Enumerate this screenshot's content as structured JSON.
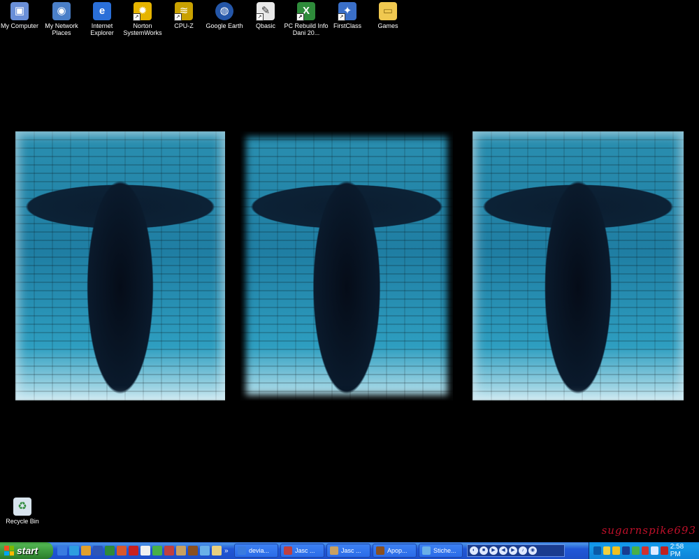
{
  "desktop": {
    "icons": [
      {
        "label": "My Computer",
        "icon": "computer-icon",
        "color": "#6a8fd8",
        "glyph": "▣"
      },
      {
        "label": "My Network Places",
        "icon": "network-icon",
        "color": "#4a7fc8",
        "glyph": "◉"
      },
      {
        "label": "Internet Explorer",
        "icon": "ie-icon",
        "color": "#2a6fd8",
        "glyph": "e"
      },
      {
        "label": "Norton SystemWorks",
        "icon": "norton-icon",
        "color": "#e6b400",
        "glyph": "✹"
      },
      {
        "label": "CPU-Z",
        "icon": "cpuz-icon",
        "color": "#c9a100",
        "glyph": "≋"
      },
      {
        "label": "Google Earth",
        "icon": "google-earth-icon",
        "color": "#2456a8",
        "glyph": "◍"
      },
      {
        "label": "Qbasic",
        "icon": "qbasic-icon",
        "color": "#e8e8e8",
        "glyph": "✎"
      },
      {
        "label": "PC Rebuild Info Dani 20...",
        "icon": "excel-icon",
        "color": "#2e8b3a",
        "glyph": "X"
      },
      {
        "label": "FirstClass",
        "icon": "firstclass-icon",
        "color": "#3a6fc8",
        "glyph": "✦"
      },
      {
        "label": "Games",
        "icon": "folder-icon",
        "color": "#f0c850",
        "glyph": "▭"
      }
    ],
    "recycle_bin": {
      "label": "Recycle Bin",
      "icon": "recycle-bin-icon"
    },
    "watermark": "sugarnspike693"
  },
  "taskbar": {
    "start_label": "start",
    "quick_launch": [
      {
        "icon": "ie-quicklaunch-icon",
        "color": "#3a7be0"
      },
      {
        "icon": "ie-quicklaunch-icon-2",
        "color": "#2d9de0"
      },
      {
        "icon": "media-quicklaunch-icon",
        "color": "#e0a02d"
      },
      {
        "icon": "word-quicklaunch-icon",
        "color": "#2d56b8"
      },
      {
        "icon": "excel-quicklaunch-icon",
        "color": "#2e8b3a"
      },
      {
        "icon": "powerpoint-quicklaunch-icon",
        "color": "#d8582d"
      },
      {
        "icon": "acrobat-quicklaunch-icon",
        "color": "#c82020"
      },
      {
        "icon": "player-quicklaunch-icon",
        "color": "#f0f0f0"
      },
      {
        "icon": "messenger-quicklaunch-icon",
        "color": "#48b048"
      },
      {
        "icon": "jasc-quicklaunch-icon",
        "color": "#c04040"
      },
      {
        "icon": "paint-quicklaunch-icon",
        "color": "#c8a060"
      },
      {
        "icon": "apophysis-quicklaunch-icon",
        "color": "#8a5020"
      },
      {
        "icon": "photo-quicklaunch-icon",
        "color": "#6ab0e8"
      },
      {
        "icon": "explorer-quicklaunch-icon",
        "color": "#e8d080"
      }
    ],
    "more_label": "»",
    "tasks": [
      {
        "label": "devia...",
        "icon": "ie-task-icon",
        "color": "#3a7be0"
      },
      {
        "label": "Jasc ...",
        "icon": "jasc-task-icon",
        "color": "#c04040"
      },
      {
        "label": "Jasc ...",
        "icon": "jasc-task-icon",
        "color": "#c8a060"
      },
      {
        "label": "Apop...",
        "icon": "apophysis-task-icon",
        "color": "#8a5020"
      },
      {
        "label": "Stiche...",
        "icon": "stiche-task-icon",
        "color": "#6ab0e8"
      }
    ],
    "clock": "2:58 PM"
  }
}
